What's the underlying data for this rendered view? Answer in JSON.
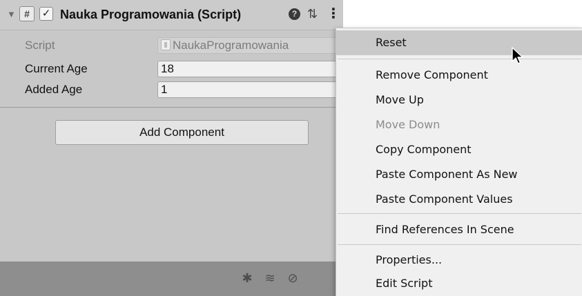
{
  "component": {
    "foldout_glyph": "▼",
    "icon_glyph": "#",
    "enabled_glyph": "✓",
    "title": "Nauka Programowania (Script)",
    "help_glyph": "?",
    "presets_glyph": "⇅",
    "menu_glyph": "⋮",
    "properties": [
      {
        "label": "Script",
        "value": "NaukaProgramowania",
        "disabled": true
      },
      {
        "label": "Current Age",
        "value": "18",
        "disabled": false
      },
      {
        "label": "Added Age",
        "value": "1",
        "disabled": false
      }
    ]
  },
  "add_component": {
    "label": "Add Component"
  },
  "status_bar": {
    "icons": [
      "bug-icon",
      "database-icon",
      "refresh-disabled-icon"
    ],
    "glyphs": [
      "✱",
      "≋",
      "⊘"
    ]
  },
  "context_menu": {
    "items": [
      {
        "label": "Reset",
        "state": "highlighted"
      },
      {
        "label": "Remove Component",
        "state": "normal"
      },
      {
        "label": "Move Up",
        "state": "normal"
      },
      {
        "label": "Move Down",
        "state": "disabled"
      },
      {
        "label": "Copy Component",
        "state": "normal"
      },
      {
        "label": "Paste Component As New",
        "state": "normal"
      },
      {
        "label": "Paste Component Values",
        "state": "normal"
      },
      {
        "label": "Find References In Scene",
        "state": "normal"
      },
      {
        "label": "Properties...",
        "state": "normal"
      },
      {
        "label": "Edit Script",
        "state": "normal"
      }
    ]
  },
  "colors": {
    "panel_background": "#c8c8c8",
    "header_background": "#cbcbcb",
    "menu_background": "#f0f0f0",
    "menu_highlight": "#c9c9c9",
    "status_bar": "#8e8e8e"
  }
}
